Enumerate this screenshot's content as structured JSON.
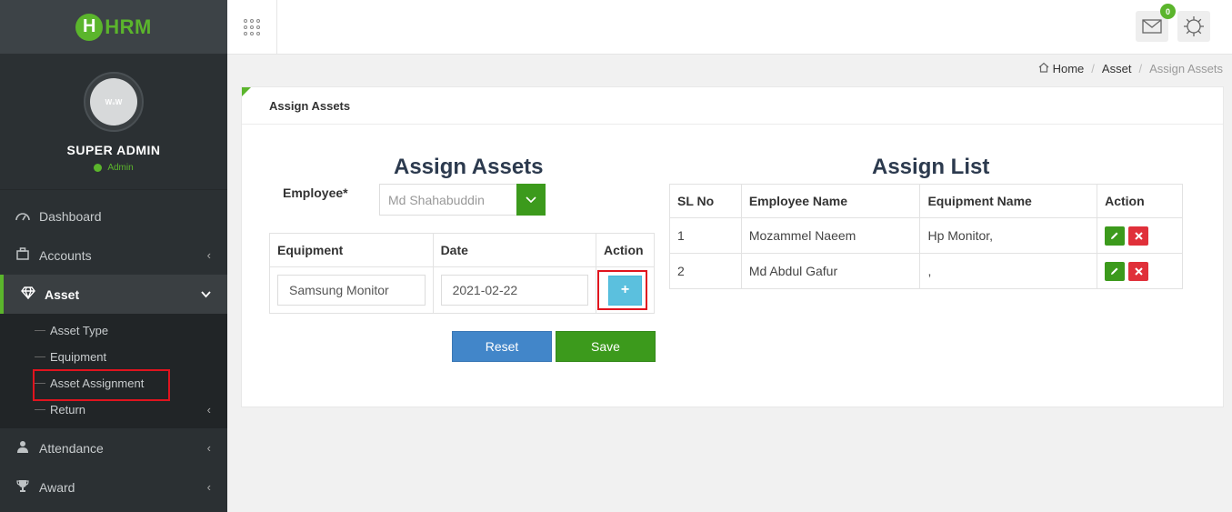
{
  "app": {
    "logo_letter": "H",
    "logo_text": "HRM"
  },
  "profile": {
    "avatar_text": "W₀W",
    "name": "SUPER ADMIN",
    "role": "Admin"
  },
  "sidebar": {
    "items": [
      {
        "label": "Dashboard",
        "icon": "dashboard-icon"
      },
      {
        "label": "Accounts",
        "icon": "briefcase-icon"
      },
      {
        "label": "Asset",
        "icon": "diamond-icon"
      },
      {
        "label": "Attendance",
        "icon": "user-icon"
      },
      {
        "label": "Award",
        "icon": "trophy-icon"
      }
    ],
    "asset_sub": [
      "Asset Type",
      "Equipment",
      "Asset Assignment",
      "Return"
    ]
  },
  "topbar": {
    "mail_badge": "0"
  },
  "breadcrumb": {
    "home": "Home",
    "section": "Asset",
    "current": "Assign Assets"
  },
  "card": {
    "header": "Assign Assets"
  },
  "assign_form": {
    "title": "Assign Assets",
    "employee_label": "Employee*",
    "employee_value": "Md Shahabuddin",
    "columns": [
      "Equipment",
      "Date",
      "Action"
    ],
    "equipment_value": "Samsung Monitor",
    "date_value": "2021-02-22",
    "add_label": "+",
    "reset_label": "Reset",
    "save_label": "Save"
  },
  "assign_list": {
    "title": "Assign List",
    "columns": [
      "SL No",
      "Employee Name",
      "Equipment Name",
      "Action"
    ],
    "rows": [
      {
        "sl": "1",
        "employee": "Mozammel Naeem",
        "equipment": "Hp Monitor,"
      },
      {
        "sl": "2",
        "employee": "Md Abdul Gafur",
        "equipment": ","
      }
    ]
  },
  "colors": {
    "accent": "#5bb52c",
    "sidebar": "#2b3033",
    "primary": "#4286c9",
    "success": "#3c9a1c",
    "danger": "#e0303a",
    "info": "#5bc0de",
    "highlight": "#e0141e"
  }
}
